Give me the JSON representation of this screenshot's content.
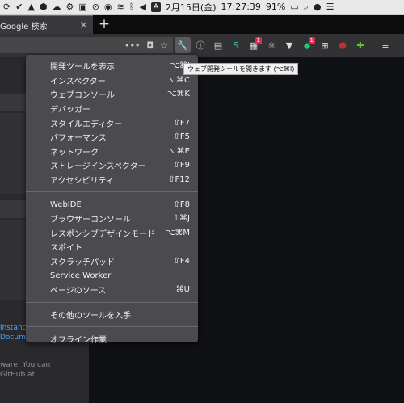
{
  "menubar": {
    "date": "2月15日(金)",
    "time": "17:27:39",
    "battery": "91%",
    "input_badge": "A"
  },
  "tab": {
    "title": "Google 検索",
    "close": "×",
    "new_tab": "+"
  },
  "toolbar": {
    "dots": "•••",
    "badges": {
      "ext1": "1",
      "ext2": "1"
    }
  },
  "tooltip": "ウェブ開発ツールを開きます (⌥⌘I)",
  "left_content": {
    "lines": [
      "instanc",
      "Docum",
      "ware. You can",
      "GitHub at"
    ]
  },
  "menu": {
    "group1": [
      {
        "label": "開発ツールを表示",
        "shortcut": "⌥⌘I"
      },
      {
        "label": "インスペクター",
        "shortcut": "⌥⌘C"
      },
      {
        "label": "ウェブコンソール",
        "shortcut": "⌥⌘K"
      },
      {
        "label": "デバッガー",
        "shortcut": ""
      },
      {
        "label": "スタイルエディター",
        "shortcut": "⇧F7"
      },
      {
        "label": "パフォーマンス",
        "shortcut": "⇧F5"
      },
      {
        "label": "ネットワーク",
        "shortcut": "⌥⌘E"
      },
      {
        "label": "ストレージインスペクター",
        "shortcut": "⇧F9"
      },
      {
        "label": "アクセシビリティ",
        "shortcut": "⇧F12"
      }
    ],
    "group2": [
      {
        "label": "WebIDE",
        "shortcut": "⇧F8"
      },
      {
        "label": "ブラウザーコンソール",
        "shortcut": "⇧⌘J"
      },
      {
        "label": "レスポンシブデザインモード",
        "shortcut": "⌥⌘M"
      },
      {
        "label": "スポイト",
        "shortcut": ""
      },
      {
        "label": "スクラッチパッド",
        "shortcut": "⇧F4"
      },
      {
        "label": "Service Worker",
        "shortcut": ""
      },
      {
        "label": "ページのソース",
        "shortcut": "⌘U"
      }
    ],
    "group3": [
      {
        "label": "その他のツールを入手",
        "shortcut": ""
      }
    ],
    "group4": [
      {
        "label": "オフライン作業",
        "shortcut": ""
      }
    ]
  },
  "colors": {
    "menu_bg": "#4a4a4f",
    "accent": "#0a84ff",
    "badge": "#e22850"
  }
}
